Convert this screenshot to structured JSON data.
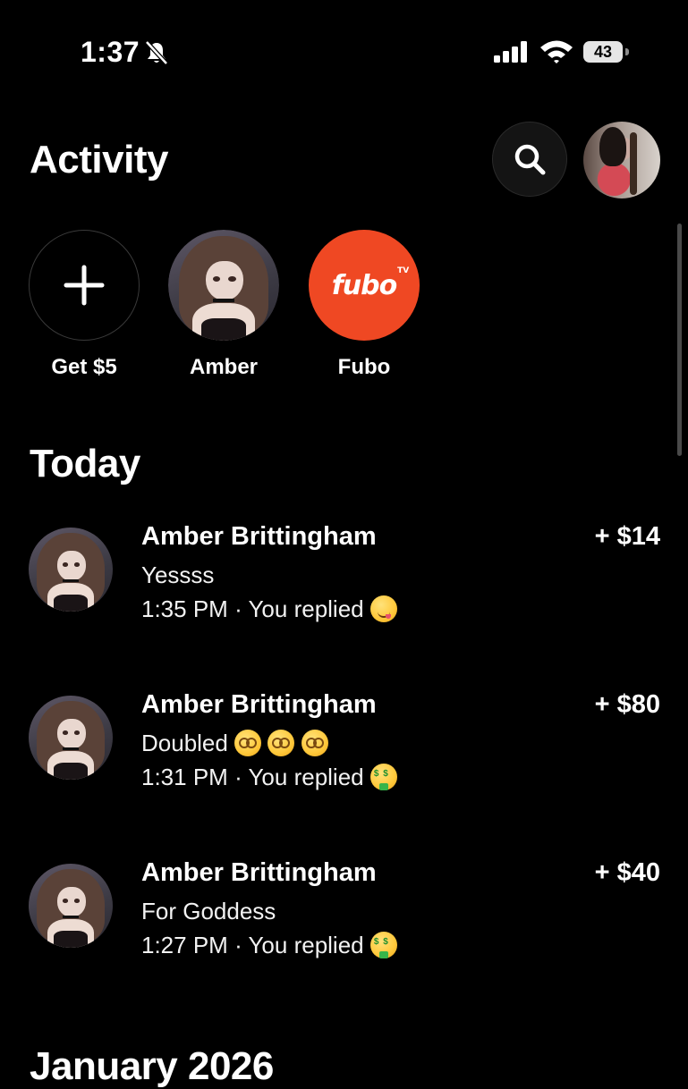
{
  "status_bar": {
    "time": "1:37",
    "battery": "43",
    "icons": [
      "bell-slash-icon",
      "signal-icon",
      "wifi-icon",
      "battery-icon"
    ]
  },
  "header": {
    "title": "Activity",
    "search_icon": "search-icon"
  },
  "shortcuts": [
    {
      "label": "Get $5",
      "icon": "plus-icon"
    },
    {
      "label": "Amber",
      "icon": "avatar"
    },
    {
      "label": "Fubo",
      "logo_text": "fubo",
      "logo_sup": "TV",
      "color": "#ef4823"
    }
  ],
  "sections": [
    {
      "title": "Today",
      "items": [
        {
          "name": "Amber Brittingham",
          "message": "Yessss",
          "time": "1:35 PM",
          "meta": "· You replied",
          "amount": "+ $14",
          "reaction": "yum-emoji"
        },
        {
          "name": "Amber Brittingham",
          "message": "Doubled",
          "message_emojis": [
            "dizzy-emoji",
            "dizzy-emoji",
            "dizzy-emoji"
          ],
          "time": "1:31 PM",
          "meta": "· You replied",
          "amount": "+ $80",
          "reaction": "money-mouth-emoji"
        },
        {
          "name": "Amber Brittingham",
          "message": "For Goddess",
          "time": "1:27 PM",
          "meta": "· You replied",
          "amount": "+ $40",
          "reaction": "money-mouth-emoji"
        }
      ]
    },
    {
      "title": "January 2026"
    }
  ],
  "colors": {
    "background": "#000000",
    "text": "#ffffff",
    "fubo": "#ef4823"
  }
}
